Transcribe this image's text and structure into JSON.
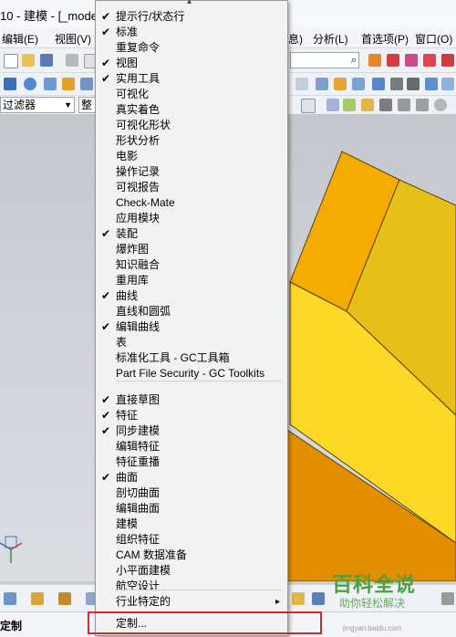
{
  "window": {
    "title": "10 - 建模 - [_mode"
  },
  "menubar": {
    "items": [
      "编辑(E)",
      "视图(V)",
      "息)",
      "分析(L)",
      "首选项(P)",
      "窗口(O)"
    ]
  },
  "selection_filter": {
    "value": "过滤器",
    "scope": "整"
  },
  "context_menu": {
    "items": [
      {
        "label": "提示行/状态行",
        "checked": true
      },
      {
        "label": "标准",
        "checked": true
      },
      {
        "label": "重复命令",
        "checked": false
      },
      {
        "label": "视图",
        "checked": true
      },
      {
        "label": "实用工具",
        "checked": true
      },
      {
        "label": "可视化",
        "checked": false
      },
      {
        "label": "真实着色",
        "checked": false
      },
      {
        "label": "可视化形状",
        "checked": false
      },
      {
        "label": "形状分析",
        "checked": false
      },
      {
        "label": "电影",
        "checked": false
      },
      {
        "label": "操作记录",
        "checked": false
      },
      {
        "label": "可视报告",
        "checked": false
      },
      {
        "label": "Check-Mate",
        "checked": false
      },
      {
        "label": "应用模块",
        "checked": false
      },
      {
        "label": "装配",
        "checked": true
      },
      {
        "label": "爆炸图",
        "checked": false
      },
      {
        "label": "知识融合",
        "checked": false
      },
      {
        "label": "重用库",
        "checked": false
      },
      {
        "label": "曲线",
        "checked": true
      },
      {
        "label": "直线和圆弧",
        "checked": false
      },
      {
        "label": "编辑曲线",
        "checked": true
      },
      {
        "label": "表",
        "checked": false
      },
      {
        "label": "标准化工具 - GC工具箱",
        "checked": false
      },
      {
        "label": "Part File Security - GC Toolkits",
        "checked": false
      },
      {
        "label": "直接草图",
        "checked": true
      },
      {
        "label": "特征",
        "checked": true
      },
      {
        "label": "同步建模",
        "checked": true
      },
      {
        "label": "编辑特征",
        "checked": false
      },
      {
        "label": "特征重播",
        "checked": false
      },
      {
        "label": "曲面",
        "checked": true
      },
      {
        "label": "剖切曲面",
        "checked": false
      },
      {
        "label": "编辑曲面",
        "checked": false
      },
      {
        "label": "建模",
        "checked": false
      },
      {
        "label": "组织特征",
        "checked": false
      },
      {
        "label": "CAM 数据准备",
        "checked": false
      },
      {
        "label": "小平面建模",
        "checked": false
      },
      {
        "label": "航空设计",
        "checked": false
      }
    ],
    "submenu_label": "行业特定的",
    "customize_label": "定制...",
    "check_mark": "✔",
    "submenu_arrow": "▸",
    "scroll_up_arrow": "▴"
  },
  "statusbar": {
    "text": "定制"
  },
  "watermark": {
    "title": "百科全说",
    "subtitle": "助你轻松解决",
    "url": "jingyan.baidu.com"
  },
  "colors": {
    "model_top": "#f4ac00",
    "model_front": "#fdd826",
    "model_side": "#e38e00",
    "highlight_box": "#d9262b"
  }
}
